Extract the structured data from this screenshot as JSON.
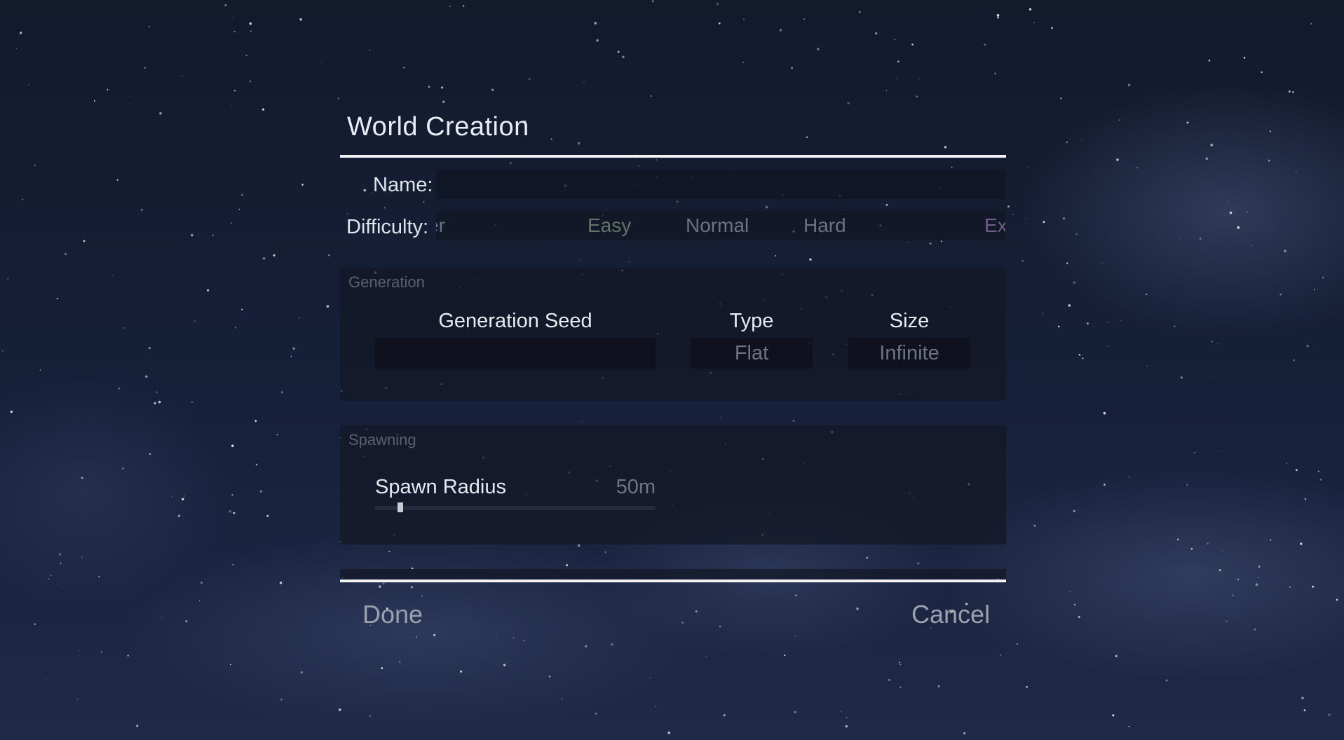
{
  "dialog": {
    "title": "World Creation",
    "name": {
      "label": "Name:",
      "value": ""
    },
    "difficulty": {
      "label": "Difficulty:",
      "options": [
        "Peaceful",
        "Easy",
        "Normal",
        "Hard",
        "Extreme"
      ],
      "visible_text": [
        "er",
        "Easy",
        "Normal",
        "Hard",
        "Ex"
      ]
    },
    "generation": {
      "title": "Generation",
      "seed": {
        "label": "Generation Seed",
        "value": ""
      },
      "type": {
        "label": "Type",
        "value": "Flat"
      },
      "size": {
        "label": "Size",
        "value": "Infinite"
      }
    },
    "spawning": {
      "title": "Spawning",
      "spawn_radius": {
        "label": "Spawn Radius",
        "value": "50m",
        "slider_fraction": 0.09
      }
    },
    "actions": {
      "done": "Done",
      "cancel": "Cancel"
    }
  },
  "colors": {
    "background": "#17203a",
    "rule": "#f2f2f2",
    "text": "#e7eaf2",
    "muted": "#6e7384",
    "extreme": "#6f5a88"
  }
}
